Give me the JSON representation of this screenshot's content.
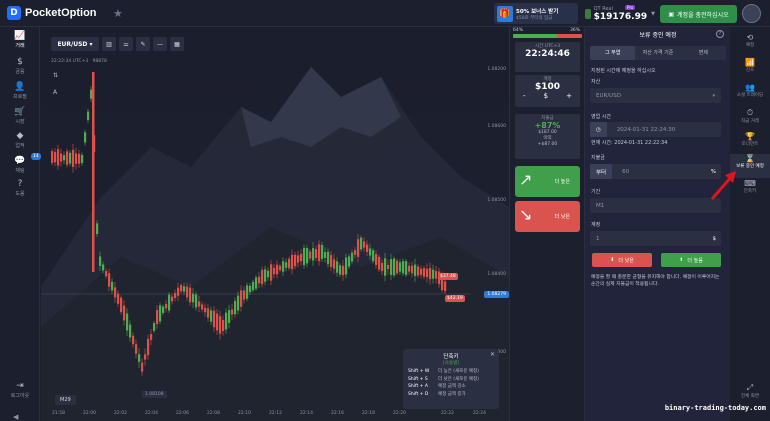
{
  "header": {
    "brand": "PocketOption",
    "logo_letter": "D",
    "bonus_title": "50% 보너스 받기",
    "bonus_sub": "$50로 부터의 입금",
    "account_type": "QT Real",
    "pro_badge": "Pro",
    "balance": "$19176.99",
    "topup_label": "계정을 충전하십시오"
  },
  "left_nav": [
    {
      "icon": "chart-icon",
      "glyph": "📈",
      "label": "거래"
    },
    {
      "icon": "dollar-icon",
      "glyph": "$",
      "label": "금융"
    },
    {
      "icon": "person-icon",
      "glyph": "👤",
      "label": "프로필"
    },
    {
      "icon": "cart-icon",
      "glyph": "🛒",
      "label": "시장"
    },
    {
      "icon": "diamond-icon",
      "glyph": "◆",
      "label": "업적"
    },
    {
      "icon": "chat-icon",
      "glyph": "💬",
      "label": "채팅"
    },
    {
      "icon": "help-icon",
      "glyph": "?",
      "label": "도움"
    },
    {
      "icon": "logout-icon",
      "glyph": "⇥",
      "label": "로그아웃"
    }
  ],
  "chat_badge": "14",
  "chart": {
    "pair": "EUR/USD",
    "time_info": "22:22:34 UTC+3",
    "price_ticker": "98878",
    "timeframe": "M29",
    "price_box": "1.08108",
    "current_price": "1.08279",
    "price_labels": [
      "1.08600",
      "1.08500",
      "1.08400",
      "1.08300",
      "1.08200"
    ],
    "x_labels": [
      "21:58",
      "22:00",
      "22:02",
      "22:04",
      "22:06",
      "22:08",
      "22:10",
      "22:12",
      "22:14",
      "22:16",
      "22:18",
      "22:20",
      "22:22",
      "22:24"
    ],
    "trade_tags": [
      "$37.48",
      "$42.19"
    ]
  },
  "shortcuts": {
    "title": "단축키",
    "subtitle": "[사용법]",
    "rows": [
      {
        "key": "Shift + W",
        "desc": "더 높은 (새로운 예정)"
      },
      {
        "key": "Shift + S",
        "desc": "더 낮은 (새로운 예정)"
      },
      {
        "key": "Shift + A",
        "desc": "예정 금액 감소"
      },
      {
        "key": "Shift + D",
        "desc": "예정 금액 증가"
      }
    ]
  },
  "trade_panel": {
    "sentiment_left": "64%",
    "sentiment_right": "36%",
    "sentiment_up_fraction": 0.64,
    "time_label": "시간 UTC+3",
    "time_value": "22:24:46",
    "amount_label": "계정",
    "amount_value": "$100",
    "payout_label": "지불금",
    "payout_pct": "+87%",
    "payout_amount": "$187.00",
    "payout_profit_label": "이익",
    "payout_profit": "+$87.00",
    "up_label": "더 높은",
    "down_label": "더 낮은"
  },
  "pending": {
    "title": "보류 중인 예정",
    "tabs": [
      "그 무엽",
      "자산 가격 기준",
      "면제"
    ],
    "desc": "지정된 시간에 예정을 하십시오",
    "asset_label": "자산",
    "asset_value": "EUR/USD",
    "open_time_label": "영업 시간",
    "open_time_value": "2024-01-31 22:24:30",
    "now_label": "현재 시간:",
    "now_value": "2024-01-31 22:22:34",
    "payout_label": "지불금",
    "payout_prefix": "부터",
    "payout_value": "60",
    "payout_suffix": "%",
    "period_label": "기간",
    "period_value": "M1",
    "amount_label": "계정",
    "amount_value": "1",
    "amount_suffix": "$",
    "btn_down": "더 낮은",
    "btn_up": "더 높음",
    "note": "예정을 할 때 충분한 균형을 유지해야 합니다. 예정이 이루어지는 순간의 실제 지불금이 적용됩니다."
  },
  "right_nav": [
    {
      "icon": "history-icon",
      "glyph": "⟲",
      "label": "예정"
    },
    {
      "icon": "signals-icon",
      "glyph": "📶",
      "label": "신호"
    },
    {
      "icon": "social-icon",
      "glyph": "👥",
      "label": "소셜 트레이딩"
    },
    {
      "icon": "express-icon",
      "glyph": "⏱",
      "label": "직급 거래"
    },
    {
      "icon": "tournament-icon",
      "glyph": "🏆",
      "label": "토너먼트"
    },
    {
      "icon": "hourglass-icon",
      "glyph": "⌛",
      "label": "보류 중인 예정"
    },
    {
      "icon": "keyboard-icon",
      "glyph": "⌨",
      "label": "단축키"
    },
    {
      "icon": "fullscreen-icon",
      "glyph": "⤢",
      "label": "전체 화면"
    }
  ],
  "watermark": "binary-trading-today.com",
  "colors": {
    "up": "#4caf50",
    "down": "#d9534f",
    "accent": "#2f7bd8"
  }
}
